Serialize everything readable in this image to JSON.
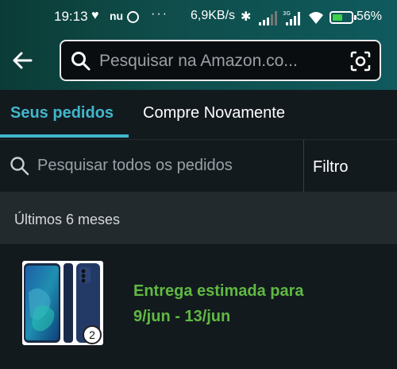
{
  "status_bar": {
    "time": "19:13",
    "carrier_icon_text": "nu",
    "overflow": "···",
    "speed": "6,9KB/s",
    "battery_pct": "56%",
    "battery_level": 0.56
  },
  "header": {
    "search_placeholder": "Pesquisar na Amazon.co..."
  },
  "tabs": [
    {
      "label": "Seus pedidos",
      "active": true
    },
    {
      "label": "Compre Novamente",
      "active": false
    }
  ],
  "order_search": {
    "placeholder": "Pesquisar todos os pedidos",
    "filter_label": "Filtro"
  },
  "section": {
    "label": "Últimos 6 meses"
  },
  "orders": [
    {
      "quantity": "2",
      "status_line1": "Entrega estimada para",
      "status_line2": "9/jun - 13/jun"
    }
  ],
  "colors": {
    "accent": "#41b7cc",
    "delivery": "#5fb943",
    "header_gradient_start": "#0b3b36",
    "header_gradient_end": "#0f5a5e"
  }
}
